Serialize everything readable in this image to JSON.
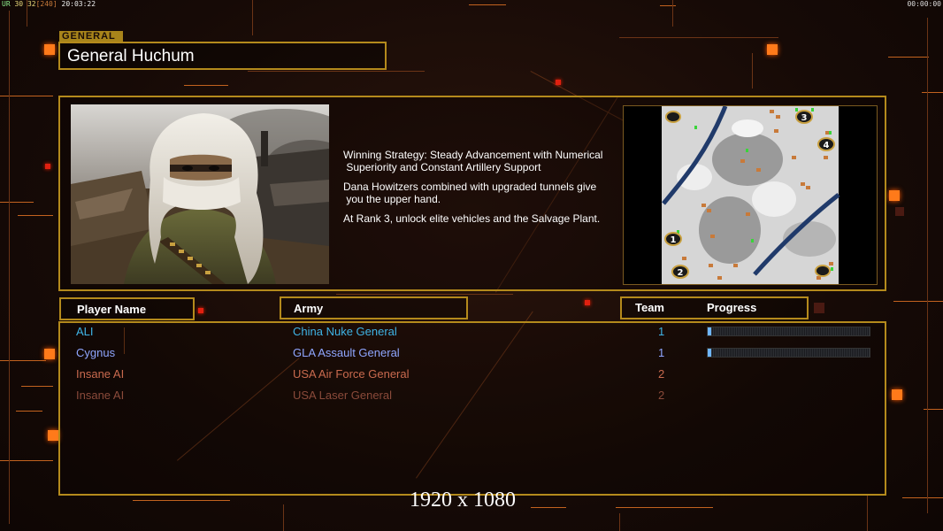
{
  "hud": {
    "left_1": "UR",
    "left_2": "30",
    "left_3": "32",
    "left_4": "[240]",
    "left_5": "20:03:22",
    "right": "00:00:00"
  },
  "general": {
    "tag": "GENERAL",
    "name": "General Huchum",
    "portrait_icon": "general-portrait-image",
    "description": [
      "Winning Strategy: Steady Advancement with Numerical\n Superiority and Constant Artillery Support",
      "Dana Howitzers combined with upgraded tunnels give\n you the upper hand.",
      "At Rank 3, unlock elite vehicles and the Salvage Plant."
    ]
  },
  "map": {
    "start_positions": [
      "1",
      "2",
      "3",
      "4"
    ]
  },
  "columns": {
    "player_name": "Player Name",
    "army": "Army",
    "team": "Team",
    "progress": "Progress"
  },
  "players": [
    {
      "name": "ALI",
      "army": "China Nuke General",
      "team": "1",
      "progress": 0.01,
      "color": "#3fb4e6"
    },
    {
      "name": "Cygnus",
      "army": "GLA Assault General",
      "team": "1",
      "progress": 0.01,
      "color": "#8fa6ff"
    },
    {
      "name": "Insane AI",
      "army": "USA Air Force General",
      "team": "2",
      "color": "#c96a4e"
    },
    {
      "name": "Insane AI",
      "army": "USA Laser General",
      "team": "2",
      "color": "#8a4a3a"
    }
  ],
  "resolution_label": "1920 x 1080",
  "colors": {
    "frame": "#b48a1c",
    "accent": "#ff7a1a"
  }
}
